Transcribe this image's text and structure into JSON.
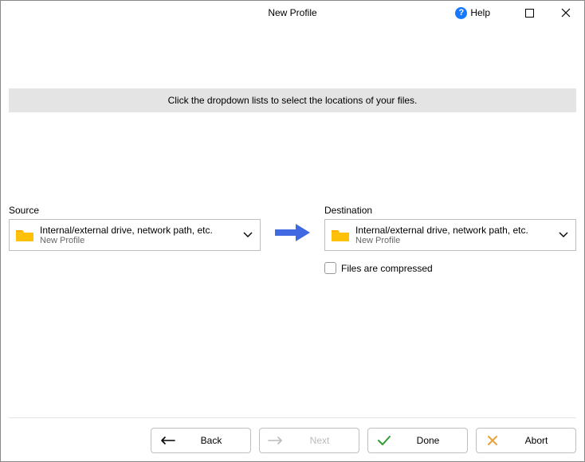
{
  "titlebar": {
    "title": "New Profile",
    "help_label": "Help"
  },
  "instruction": "Click the dropdown lists to select the locations of your files.",
  "source": {
    "label": "Source",
    "line1": "Internal/external drive, network path, etc.",
    "line2": "New Profile"
  },
  "destination": {
    "label": "Destination",
    "line1": "Internal/external drive, network path, etc.",
    "line2": "New Profile",
    "compressed_label": "Files are compressed"
  },
  "buttons": {
    "back": "Back",
    "next": "Next",
    "done": "Done",
    "abort": "Abort"
  }
}
